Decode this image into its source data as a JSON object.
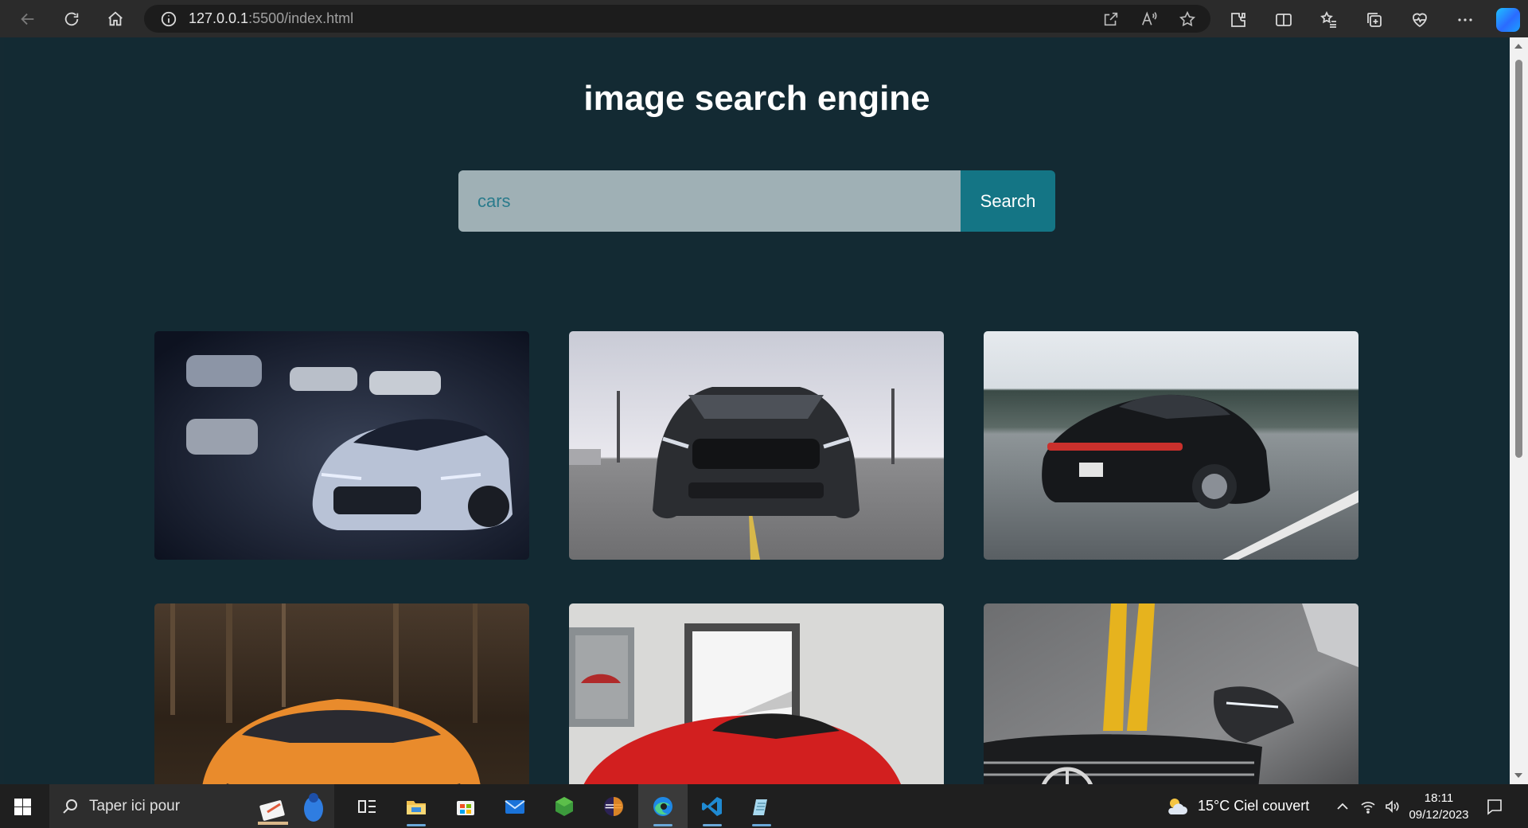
{
  "browser": {
    "url_host": "127.0.0.1",
    "url_rest": ":5500/index.html"
  },
  "page": {
    "title": "image search engine",
    "search": {
      "value": "cars",
      "button_label": "Search"
    },
    "results": [
      {
        "name": "image-camaro"
      },
      {
        "name": "image-mustang"
      },
      {
        "name": "image-porsche"
      },
      {
        "name": "image-lamborghini"
      },
      {
        "name": "image-ferrari"
      },
      {
        "name": "image-mercedes"
      }
    ]
  },
  "taskbar": {
    "search_placeholder": "Taper ici pour",
    "weather": "15°C  Ciel couvert",
    "time": "18:11",
    "date": "09/12/2023"
  },
  "colors": {
    "page_bg": "#132a33",
    "input_bg": "#9fb0b5",
    "input_text": "#2a7b8c",
    "button_bg": "#147585"
  }
}
